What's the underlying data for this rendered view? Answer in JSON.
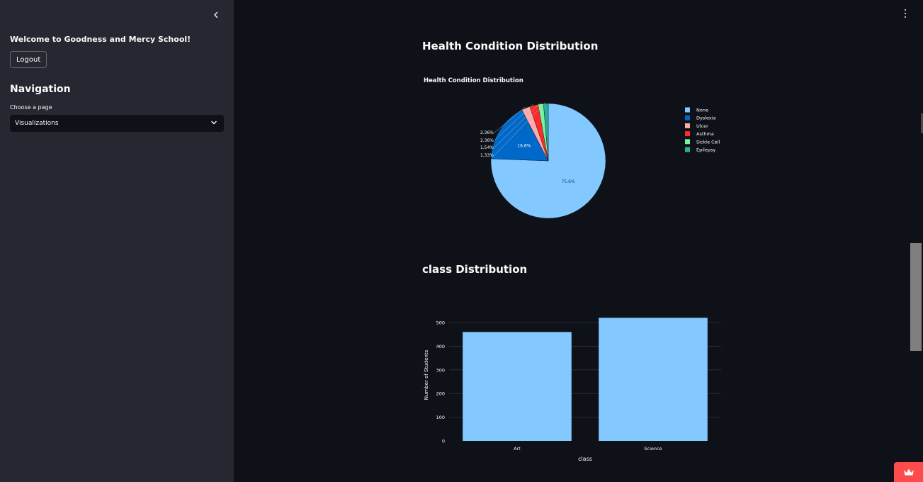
{
  "sidebar": {
    "welcome": "Welcome to Goodness and Mercy School!",
    "logout_label": "Logout",
    "nav_title": "Navigation",
    "choose_label": "Choose a page",
    "selected_page": "Visualizations"
  },
  "sections": {
    "health_title": "Health Condition Distribution",
    "class_title": "class Distribution"
  },
  "chart_data": [
    {
      "type": "pie",
      "title": "Health Condition Distribution",
      "labels": [
        "None",
        "Dyslexia",
        "Ulcer",
        "Asthma",
        "Sickle Cell",
        "Epilepsy"
      ],
      "values": [
        75.6,
        16.8,
        2.36,
        2.36,
        1.54,
        1.33
      ],
      "text_labels": [
        "75.6%",
        "16.8%",
        "2.36%",
        "2.36%",
        "1.54%",
        "1.33%"
      ],
      "colors": [
        "#83c9ff",
        "#0068c9",
        "#ffabab",
        "#ff2b2b",
        "#7defa1",
        "#29b09d"
      ],
      "legend_position": "right"
    },
    {
      "type": "bar",
      "title": "",
      "categories": [
        "Art",
        "Science"
      ],
      "values": [
        460,
        520
      ],
      "xlabel": "class",
      "ylabel": "Number of Students",
      "yticks": [
        0,
        100,
        200,
        300,
        400,
        500
      ],
      "ylim": [
        0,
        530
      ],
      "color": "#83c9ff",
      "grid": true
    }
  ]
}
